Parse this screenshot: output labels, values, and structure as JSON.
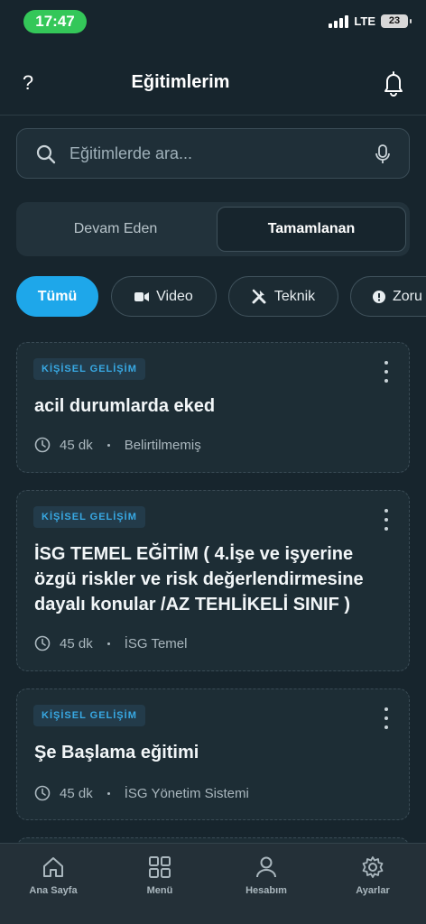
{
  "status_bar": {
    "time": "17:47",
    "network": "LTE",
    "battery": "23"
  },
  "header": {
    "help": "?",
    "title": "Eğitimlerim"
  },
  "search": {
    "placeholder": "Eğitimlerde ara..."
  },
  "segments": {
    "left": "Devam Eden",
    "right": "Tamamlanan",
    "selected": "Tamamlanan"
  },
  "chips": [
    {
      "label": "Tümü",
      "icon": "none"
    },
    {
      "label": "Video",
      "icon": "video-camera-icon"
    },
    {
      "label": "Teknik",
      "icon": "tools-icon"
    },
    {
      "label": "Zoru",
      "icon": "alert-circle-icon"
    }
  ],
  "cards": [
    {
      "category": "KİŞİSEL GELİŞİM",
      "title": "acil durumlarda eked",
      "duration": "45 dk",
      "topic": "Belirtilmemiş"
    },
    {
      "category": "KİŞİSEL GELİŞİM",
      "title": "İSG TEMEL EĞİTİM ( 4.İşe ve işyerine özgü riskler ve risk değerlendirmesine dayalı konular /AZ TEHLİKELİ SINIF )",
      "duration": "45 dk",
      "topic": "İSG Temel"
    },
    {
      "category": "KİŞİSEL GELİŞİM",
      "title": "Şe Başlama eğitimi",
      "duration": "45 dk",
      "topic": "İSG Yönetim Sistemi"
    }
  ],
  "bottom_nav": [
    {
      "label": "Ana Sayfa",
      "icon": "home-icon"
    },
    {
      "label": "Menü",
      "icon": "grid-icon"
    },
    {
      "label": "Hesabım",
      "icon": "user-icon"
    },
    {
      "label": "Ayarlar",
      "icon": "gear-icon"
    }
  ],
  "colors": {
    "background": "#17252d",
    "accent": "#1ea7ea",
    "status_green": "#34c759",
    "badge_text": "#38a9e4"
  }
}
